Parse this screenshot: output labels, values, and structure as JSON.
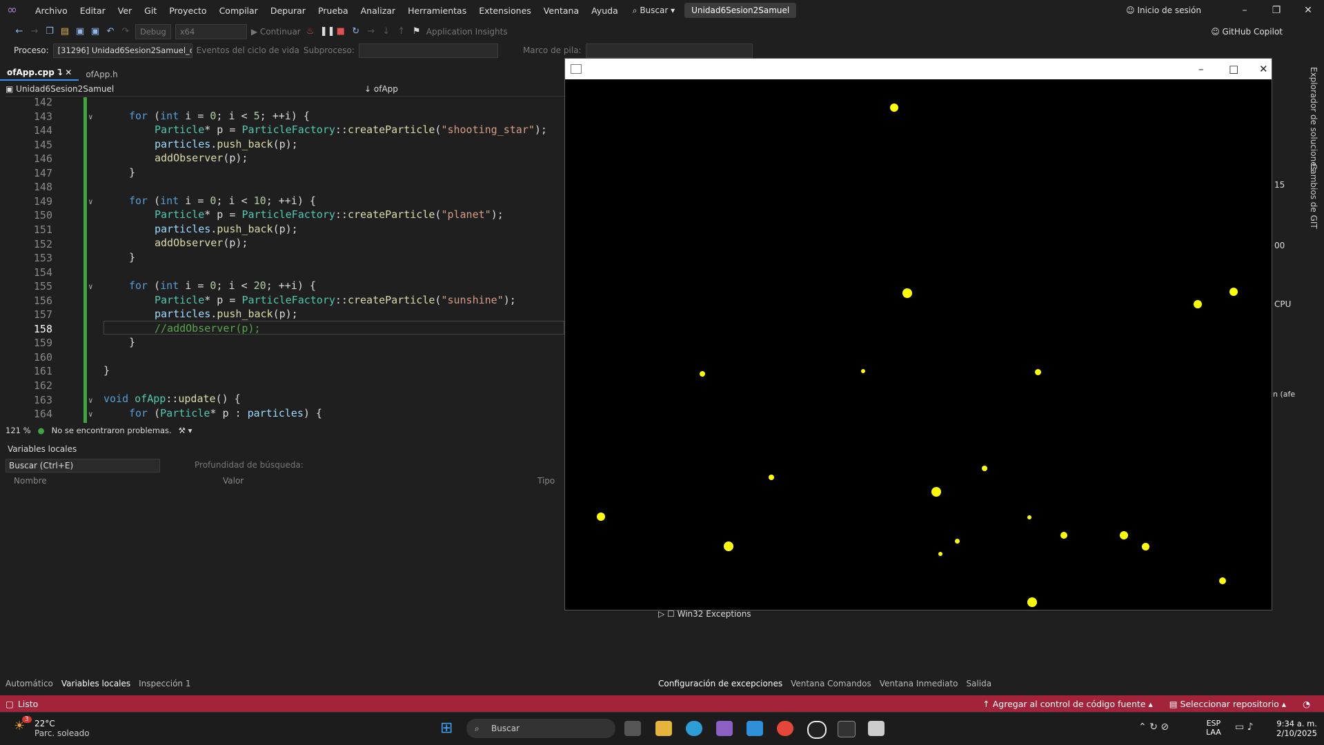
{
  "menubar": {
    "items": [
      "Archivo",
      "Editar",
      "Ver",
      "Git",
      "Proyecto",
      "Compilar",
      "Depurar",
      "Prueba",
      "Analizar",
      "Herramientas",
      "Extensiones",
      "Ventana",
      "Ayuda"
    ],
    "search": "Buscar",
    "solution": "Unidad6Sesion2Samuel",
    "login": "Inicio de sesión"
  },
  "toolbar": {
    "config": "Debug",
    "platform": "x64",
    "continue": "Continuar",
    "insights": "Application Insights",
    "copilot": "GitHub Copilot"
  },
  "procbar": {
    "label": "Proceso:",
    "process": "[31296] Unidad6Sesion2Samuel_de",
    "events": "Eventos del ciclo de vida",
    "thread": "Subproceso:",
    "stack": "Marco de pila:"
  },
  "tabs": [
    {
      "label": "ofApp.cpp"
    },
    {
      "label": "ofApp.h"
    }
  ],
  "navbar": {
    "project": "Unidad6Sesion2Samuel",
    "scope": "ofApp"
  },
  "code": {
    "lines": [
      "142",
      "143",
      "144",
      "145",
      "146",
      "147",
      "148",
      "149",
      "150",
      "151",
      "152",
      "153",
      "154",
      "155",
      "156",
      "157",
      "158",
      "159",
      "160",
      "161",
      "162",
      "163",
      "164"
    ],
    "l143": [
      "for",
      "(",
      "int",
      " i = ",
      "0",
      "; i < ",
      "5",
      "; ++i) {"
    ],
    "str_shooting": "\"shooting_star\"",
    "str_planet": "\"planet\"",
    "str_sunshine": "\"sunshine\"",
    "n10": "10",
    "n20": "20",
    "comment": "//addObserver(p);"
  },
  "editstatus": {
    "zoom": "121 %",
    "problems": "No se encontraron problemas."
  },
  "locals": {
    "title": "Variables locales",
    "search": "Buscar (Ctrl+E)",
    "depth": "Profundidad de búsqueda:",
    "cols": [
      "Nombre",
      "Valor",
      "Tipo"
    ]
  },
  "bottomtabs_left": [
    "Automático",
    "Variables locales",
    "Inspección 1"
  ],
  "bottomtabs_right": [
    "Configuración de excepciones",
    "Ventana Comandos",
    "Ventana Inmediato",
    "Salida"
  ],
  "win32": "Win32 Exceptions",
  "rightpanel": {
    "explorer": "Explorador de soluciones",
    "git": "Cambios de GIT",
    "cpu": "CPU",
    "v15": "15",
    "v00": "00",
    "afe": "n (afe"
  },
  "status": {
    "ready": "Listo",
    "source": "Agregar al control de código fuente",
    "repo": "Seleccionar repositorio"
  },
  "taskbar": {
    "temp": "22°C",
    "weather": "Parc. soleado",
    "badge": "3",
    "search": "Buscar",
    "lang1": "ESP",
    "lang2": "LAA",
    "time": "9:34 a. m.",
    "date": "2/10/2025"
  },
  "particle_color": "#ffff00"
}
